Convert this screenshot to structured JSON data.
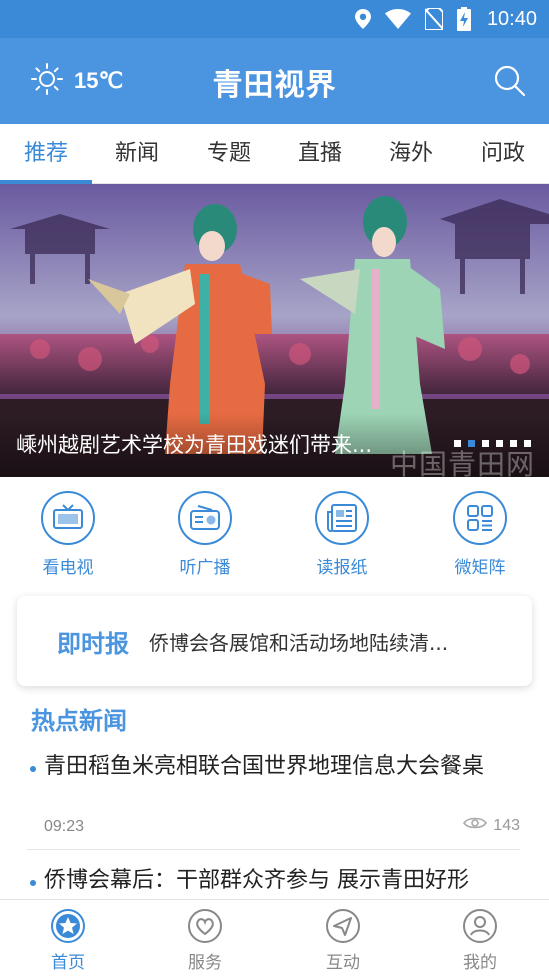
{
  "status_bar": {
    "time": "10:40"
  },
  "header": {
    "temperature": "15℃",
    "title": "青田视界",
    "weather_icon": "sun-icon",
    "search_icon": "search-icon"
  },
  "tabs": [
    {
      "label": "推荐",
      "active": true
    },
    {
      "label": "新闻"
    },
    {
      "label": "专题"
    },
    {
      "label": "直播"
    },
    {
      "label": "海外"
    },
    {
      "label": "问政"
    }
  ],
  "banner": {
    "caption": "嵊州越剧艺术学校为青田戏迷们带来...",
    "watermark": "中国青田网",
    "slides": 6,
    "active_slide": 2
  },
  "quick_links": [
    {
      "label": "看电视",
      "icon": "tv-icon"
    },
    {
      "label": "听广播",
      "icon": "radio-icon"
    },
    {
      "label": "读报纸",
      "icon": "newspaper-icon"
    },
    {
      "label": "微矩阵",
      "icon": "grid-icon"
    }
  ],
  "instant": {
    "label": "即时报",
    "text": "侨博会各展馆和活动场地陆续清..."
  },
  "hot_news": {
    "title": "热点新闻",
    "items": [
      {
        "title": "青田稻鱼米亮相联合国世界地理信息大会餐桌",
        "time": "09:23",
        "views": "143"
      },
      {
        "title": "侨博会幕后：干部群众齐参与 展示青田好形"
      }
    ]
  },
  "bottom_nav": [
    {
      "label": "首页",
      "icon": "home-star-icon",
      "active": true
    },
    {
      "label": "服务",
      "icon": "heart-icon"
    },
    {
      "label": "互动",
      "icon": "send-icon"
    },
    {
      "label": "我的",
      "icon": "user-icon"
    }
  ],
  "colors": {
    "primary": "#3a8ad8",
    "header": "#4a94e0"
  }
}
